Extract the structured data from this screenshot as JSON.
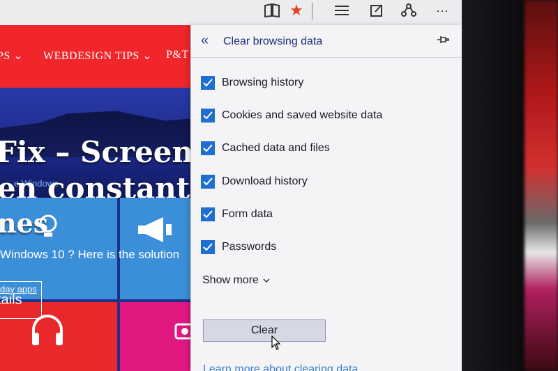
{
  "toolbar": {
    "icons": [
      "reading-view-icon",
      "favorite-star-icon",
      "hub-icon",
      "web-note-icon",
      "share-icon",
      "more-icon"
    ]
  },
  "webpage": {
    "nav": [
      "PS ⌄",
      "WEBDESIGN TIPS ⌄",
      "P&T"
    ],
    "hero_line1": "Fix – Screen",
    "hero_line2": "en constant",
    "hero_line3": "nes",
    "hero_sub": "e Windows",
    "solution": "Windows 10 ? Here is the solution",
    "dayapps": "day apps",
    "details": "tails"
  },
  "panel": {
    "title": "Clear browsing data",
    "items": [
      {
        "label": "Browsing history",
        "checked": true
      },
      {
        "label": "Cookies and saved website data",
        "checked": true
      },
      {
        "label": "Cached data and files",
        "checked": true
      },
      {
        "label": "Download history",
        "checked": true
      },
      {
        "label": "Form data",
        "checked": true
      },
      {
        "label": "Passwords",
        "checked": true
      }
    ],
    "show_more": "Show more",
    "clear_label": "Clear",
    "learn_more": "Learn more about clearing data"
  },
  "colors": {
    "checkbox": "#1f6fd0",
    "title": "#1d2f7a",
    "link": "#3b7ec8",
    "nav_red": "#f0262a",
    "tile_blue": "#3b8fd8"
  }
}
